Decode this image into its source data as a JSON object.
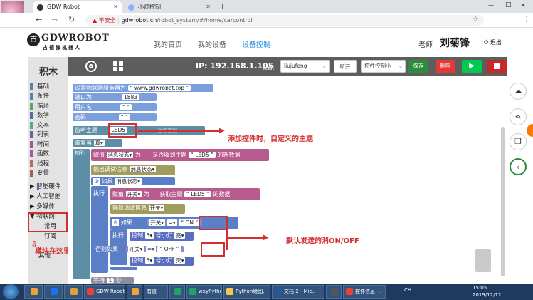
{
  "browser": {
    "tabs": [
      {
        "title": "GDW Robot",
        "active": true
      },
      {
        "title": "小灯控制",
        "active": false
      }
    ],
    "new_tab": "+",
    "address": {
      "security": "不安全",
      "host": "gdwrobot.cn",
      "path": "/robot_system/#/home/carcontrol"
    },
    "nav_icons": [
      "back-icon",
      "forward-icon",
      "reload-icon"
    ],
    "window_controls": [
      "—",
      "□",
      "✕"
    ]
  },
  "header": {
    "logo_main": "GDWROBOT",
    "logo_sub": "古德微机器人",
    "menu": [
      {
        "label": "我的首页",
        "active": false
      },
      {
        "label": "我的设备",
        "active": false
      },
      {
        "label": "设备控制",
        "active": true
      }
    ],
    "role": "老师",
    "user_name": "刘菊锋",
    "logout": "退出"
  },
  "toolbox": {
    "title": "积木",
    "categories": [
      {
        "label": "基础",
        "color": "#5c81a6"
      },
      {
        "label": "条件",
        "color": "#5c81a6"
      },
      {
        "label": "循环",
        "color": "#5ca65c"
      },
      {
        "label": "数学",
        "color": "#5c68a6"
      },
      {
        "label": "文本",
        "color": "#5ca68d"
      },
      {
        "label": "列表",
        "color": "#745ca6"
      },
      {
        "label": "时间",
        "color": "#a65c81"
      },
      {
        "label": "函数",
        "color": "#9a5ca6"
      },
      {
        "label": "线程",
        "color": "#a6745c"
      },
      {
        "label": "变量",
        "color": "#a65c5c"
      },
      {
        "label": "▶ 智能硬件",
        "color": "#5b67a5"
      },
      {
        "label": "▶ 人工智能",
        "color": ""
      },
      {
        "label": "▶ 多媒体",
        "color": ""
      },
      {
        "label": "▼ 物联网",
        "color": ""
      },
      {
        "label": "常用",
        "color": ""
      },
      {
        "label": "订阅",
        "color": ""
      },
      {
        "label": "其他",
        "color": ""
      }
    ]
  },
  "toolbar": {
    "ip_label": "IP: 192.168.1.105",
    "device_label": "设备：",
    "device_value": "liujufeng",
    "disconnect": "断开",
    "control_select": "控件控制小",
    "save": "保存",
    "delete": "删除",
    "run_icon": "play-icon",
    "stop_icon": "stop-icon"
  },
  "blocks": {
    "server_label": "设置物联网服务器为",
    "server_value": "www.gdwrobot.top",
    "port_label": "端口为",
    "port_value": "1883",
    "user_label": "用户名",
    "pass_label": "密码",
    "listen_label": "监听主题",
    "listen_topic": "LED5",
    "receive_label": "接收数据",
    "repeat_label": "重复当",
    "repeat_value": "真",
    "exec": "执行",
    "assign": "赋值",
    "var_msg": "消息状态",
    "to": "为",
    "is_received": "是否收到主题",
    "new_data": "的新数据",
    "debug_out": "输出调试信息",
    "if": "如果",
    "var_switch": "开关",
    "get_topic": "获取主题",
    "data_of": "的数据",
    "eq": "=",
    "on": "ON",
    "off": "OFF",
    "control": "控制",
    "lamp_num": "5",
    "lamp_label": "号小灯",
    "on_state": "亮",
    "off_state": "灭",
    "else_if": "否则如果",
    "wait": "等待",
    "wait_val": "1",
    "seconds": "秒"
  },
  "annotations": {
    "topic_note": "添加控件时，自定义的主题",
    "default_msg": "默认发送的消ON/OFF",
    "find_here": "模块在这里找"
  },
  "watermark": "电脑技术网 www.tagxp.com",
  "taskbar": {
    "items": [
      {
        "label": "",
        "color": "#e8a33d"
      },
      {
        "label": "",
        "color": "#1a73e8"
      },
      {
        "label": "",
        "color": "#d9a33a"
      },
      {
        "label": "GDW Robot...",
        "color": "#e94235"
      },
      {
        "label": "",
        "color": "#f2a33a"
      },
      {
        "label": "有道",
        "color": "#d32f2f"
      },
      {
        "label": "",
        "color": "#21a366"
      },
      {
        "label": "wxyPython [..",
        "color": "#21a366"
      },
      {
        "label": "Python绘图..",
        "color": "#f2c94c"
      },
      {
        "label": "文档 2 - Mic..",
        "color": "#2b579a"
      },
      {
        "label": "",
        "color": "#555"
      },
      {
        "label": "控件信息 -..",
        "color": "#e94235"
      }
    ],
    "lang": "CH",
    "time": "15:05",
    "date": "2019/12/12"
  }
}
